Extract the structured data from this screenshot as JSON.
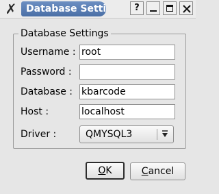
{
  "window": {
    "title": "Database Settin",
    "help_glyph": "?",
    "app_icon": "kde-x-icon",
    "controls": [
      "help-icon",
      "minimize-icon",
      "maximize-icon",
      "close-icon"
    ]
  },
  "group": {
    "title": "Database Settings"
  },
  "fields": {
    "username": {
      "label": "Username :",
      "value": "root"
    },
    "password": {
      "label": "Password :",
      "value": ""
    },
    "database": {
      "label": "Database :",
      "value": "kbarcode"
    },
    "host": {
      "label": "Host :",
      "value": "localhost"
    }
  },
  "driver": {
    "label": "Driver :",
    "selected": "QMYSQL3",
    "arrow_icon": "combo-arrow-icon"
  },
  "buttons": {
    "ok": {
      "mnemonic": "O",
      "rest": "K"
    },
    "cancel": {
      "mnemonic": "C",
      "rest": "ancel"
    }
  },
  "colors": {
    "title_active": "#4a6fa6",
    "dialog_bg": "#e6e6e6"
  }
}
